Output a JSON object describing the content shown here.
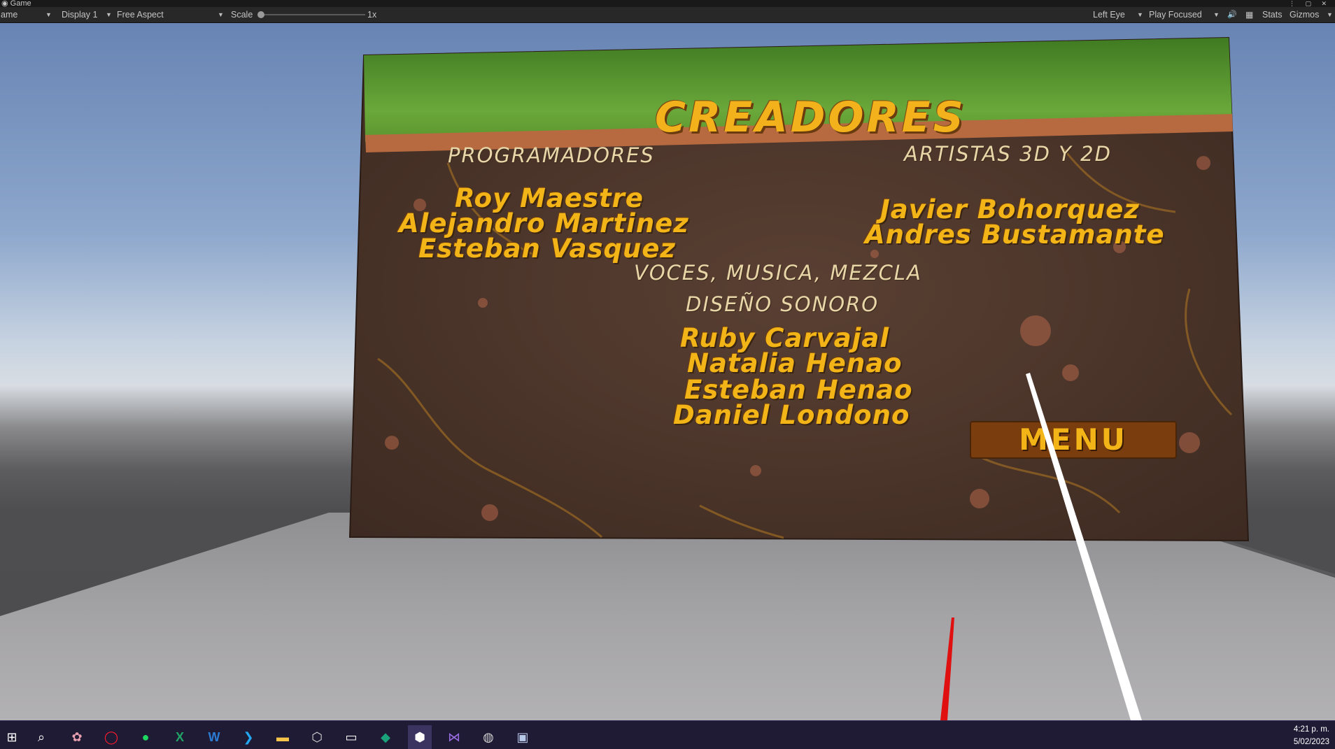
{
  "window": {
    "tab_label": "Game",
    "tab_icon": "game-controller-icon"
  },
  "toolbar": {
    "mode_select": "ame",
    "display_select": "Display 1",
    "aspect_select": "Free Aspect",
    "scale_label": "Scale",
    "scale_value": "1x",
    "eye_select": "Left Eye",
    "play_mode_select": "Play Focused",
    "stats_label": "Stats",
    "gizmos_label": "Gizmos"
  },
  "credits": {
    "title": "CREADORES",
    "programmers_heading": "PROGRAMADORES",
    "programmers": [
      "Roy Maestre",
      "Alejandro Martinez",
      "Esteban Vasquez"
    ],
    "artists_heading": "ARTISTAS 3D Y 2D",
    "artists": [
      "Javier Bohorquez",
      "Andres Bustamante"
    ],
    "sound_heading_line1": "VOCES, MUSICA, MEZCLA",
    "sound_heading_line2": "DISEÑO SONORO",
    "sound": [
      "Ruby Carvajal",
      "Natalia Henao",
      "Esteban Henao",
      "Daniel Londono"
    ],
    "menu_button": "MENU"
  },
  "taskbar": {
    "icons": [
      "windows-start-icon",
      "search-icon",
      "paint-icon",
      "opera-icon",
      "spotify-icon",
      "excel-icon",
      "word-icon",
      "vscode-icon",
      "file-explorer-icon",
      "unity-hub-icon",
      "oculus-icon",
      "app-icon",
      "unity-icon",
      "visual-studio-icon",
      "obs-icon",
      "photos-icon"
    ],
    "time": "4:21 p. m.",
    "date": "5/02/2023"
  },
  "colors": {
    "accent": "#f3b418",
    "heading": "#e9d6a8",
    "board_dirt": "#4a3328",
    "grass": "#4f8f2a",
    "menu_button_bg": "#7a3d0d",
    "taskbar": "#201b35"
  }
}
